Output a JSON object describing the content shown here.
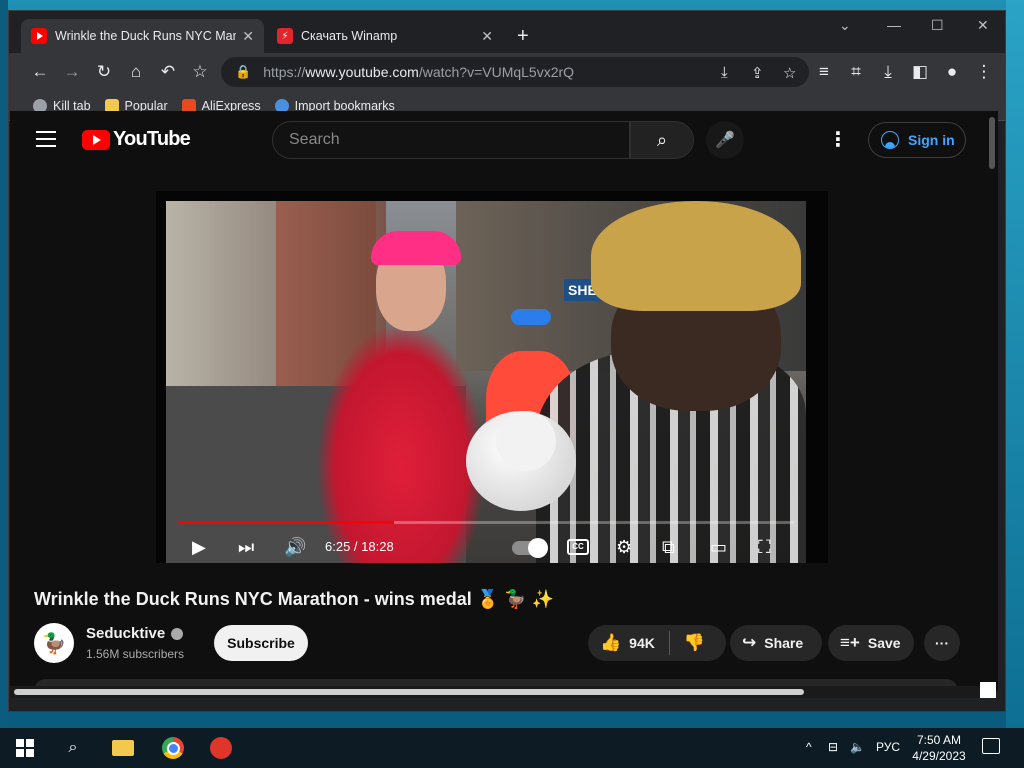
{
  "browser": {
    "tabs": [
      {
        "title": "Wrinkle the Duck Runs NYC Marathon - wins medal",
        "active": true,
        "favicon": "youtube-icon"
      },
      {
        "title": "Скачать Winamp",
        "active": false,
        "favicon": "winamp-icon"
      }
    ],
    "url_scheme": "https://",
    "url_host": "www.youtube.com",
    "url_path": "/watch?v=VUMqL5vx2rQ",
    "bookmarks": [
      {
        "label": "Kill tab",
        "icon": "globe-icon",
        "color": "#9aa0a6"
      },
      {
        "label": "Popular",
        "icon": "folder-icon",
        "color": "#f2c94c"
      },
      {
        "label": "AliExpress",
        "icon": "aliexpress-icon",
        "color": "#e8491d"
      },
      {
        "label": "Import bookmarks",
        "icon": "gear-icon",
        "color": "#4a90e2"
      }
    ]
  },
  "youtube": {
    "logo_text": "YouTube",
    "search_placeholder": "Search",
    "sign_in_label": "Sign in",
    "player": {
      "time": "6:25 / 18:28",
      "progress": 0.35,
      "sign_text": "SHERW"
    },
    "video_title": "Wrinkle the Duck Runs NYC Marathon - wins medal 🏅 🦆 ✨",
    "channel_name": "Seducktive",
    "subscribers": "1.56M subscribers",
    "subscribe_label": "Subscribe",
    "likes": "94K",
    "share_label": "Share",
    "save_label": "Save"
  },
  "taskbar": {
    "language": "РУС",
    "time": "7:50 AM",
    "date": "4/29/2023"
  }
}
